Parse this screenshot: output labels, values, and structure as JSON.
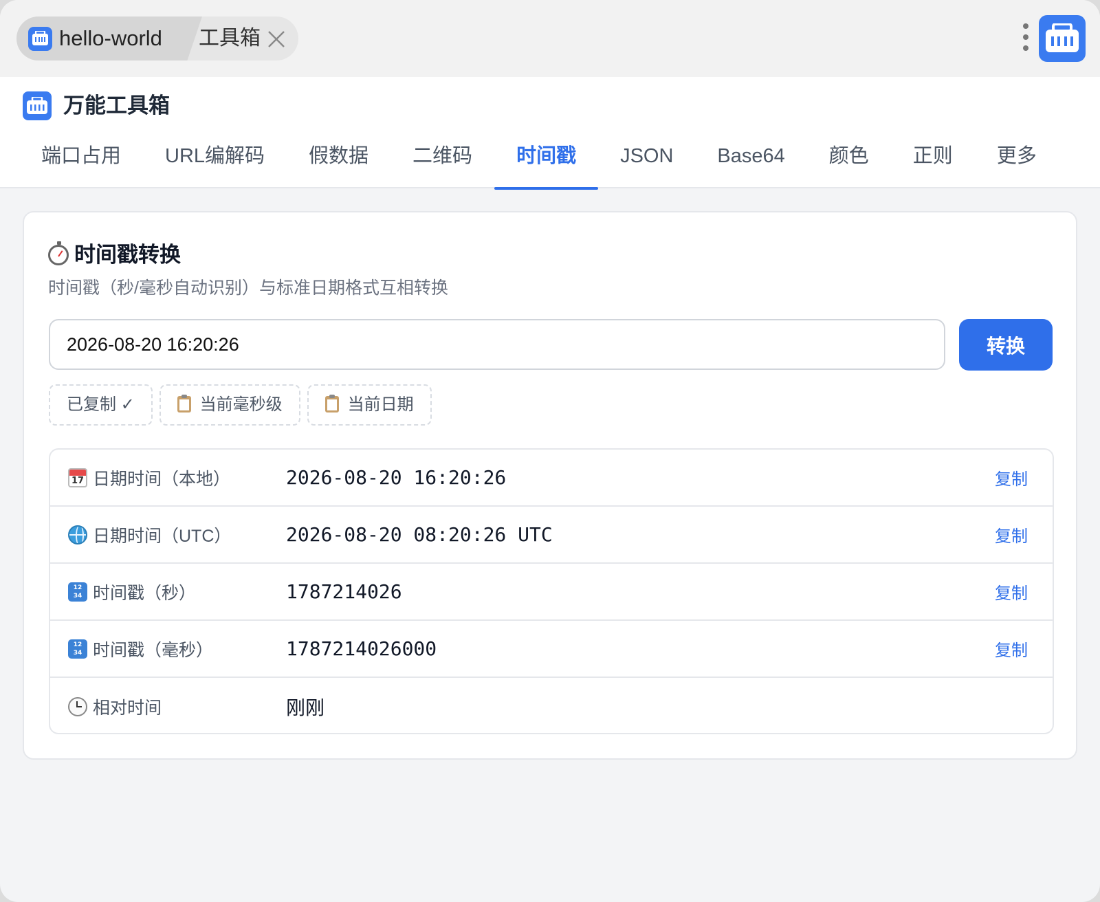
{
  "titlebar": {
    "tab_main_label": "hello-world",
    "tab_secondary_label": "工具箱"
  },
  "header": {
    "brand_title": "万能工具箱",
    "nav_tabs": [
      "端口占用",
      "URL编解码",
      "假数据",
      "二维码",
      "时间戳",
      "JSON",
      "Base64",
      "颜色",
      "正则",
      "更多"
    ],
    "active_tab": "时间戳"
  },
  "card": {
    "title": "时间戳转换",
    "description": "时间戳（秒/毫秒自动识别）与标准日期格式互相转换",
    "input_value": "2026-08-20 16:20:26",
    "convert_label": "转换",
    "chips": {
      "copied": "已复制 ✓",
      "current_ms": "当前毫秒级",
      "current_date": "当前日期"
    },
    "rows": [
      {
        "label": "日期时间（本地）",
        "value": "2026-08-20 16:20:26",
        "copy": "复制",
        "icon": "calendar-icon"
      },
      {
        "label": "日期时间（UTC）",
        "value": "2026-08-20 08:20:26 UTC",
        "copy": "复制",
        "icon": "globe-icon"
      },
      {
        "label": "时间戳（秒）",
        "value": "1787214026",
        "copy": "复制",
        "icon": "numbers-icon"
      },
      {
        "label": "时间戳（毫秒）",
        "value": "1787214026000",
        "copy": "复制",
        "icon": "numbers-icon"
      },
      {
        "label": "相对时间",
        "value": "刚刚",
        "copy": "",
        "icon": "clock-icon"
      }
    ]
  },
  "colors": {
    "accent": "#2f6fea",
    "app_icon": "#3a7bf0"
  }
}
